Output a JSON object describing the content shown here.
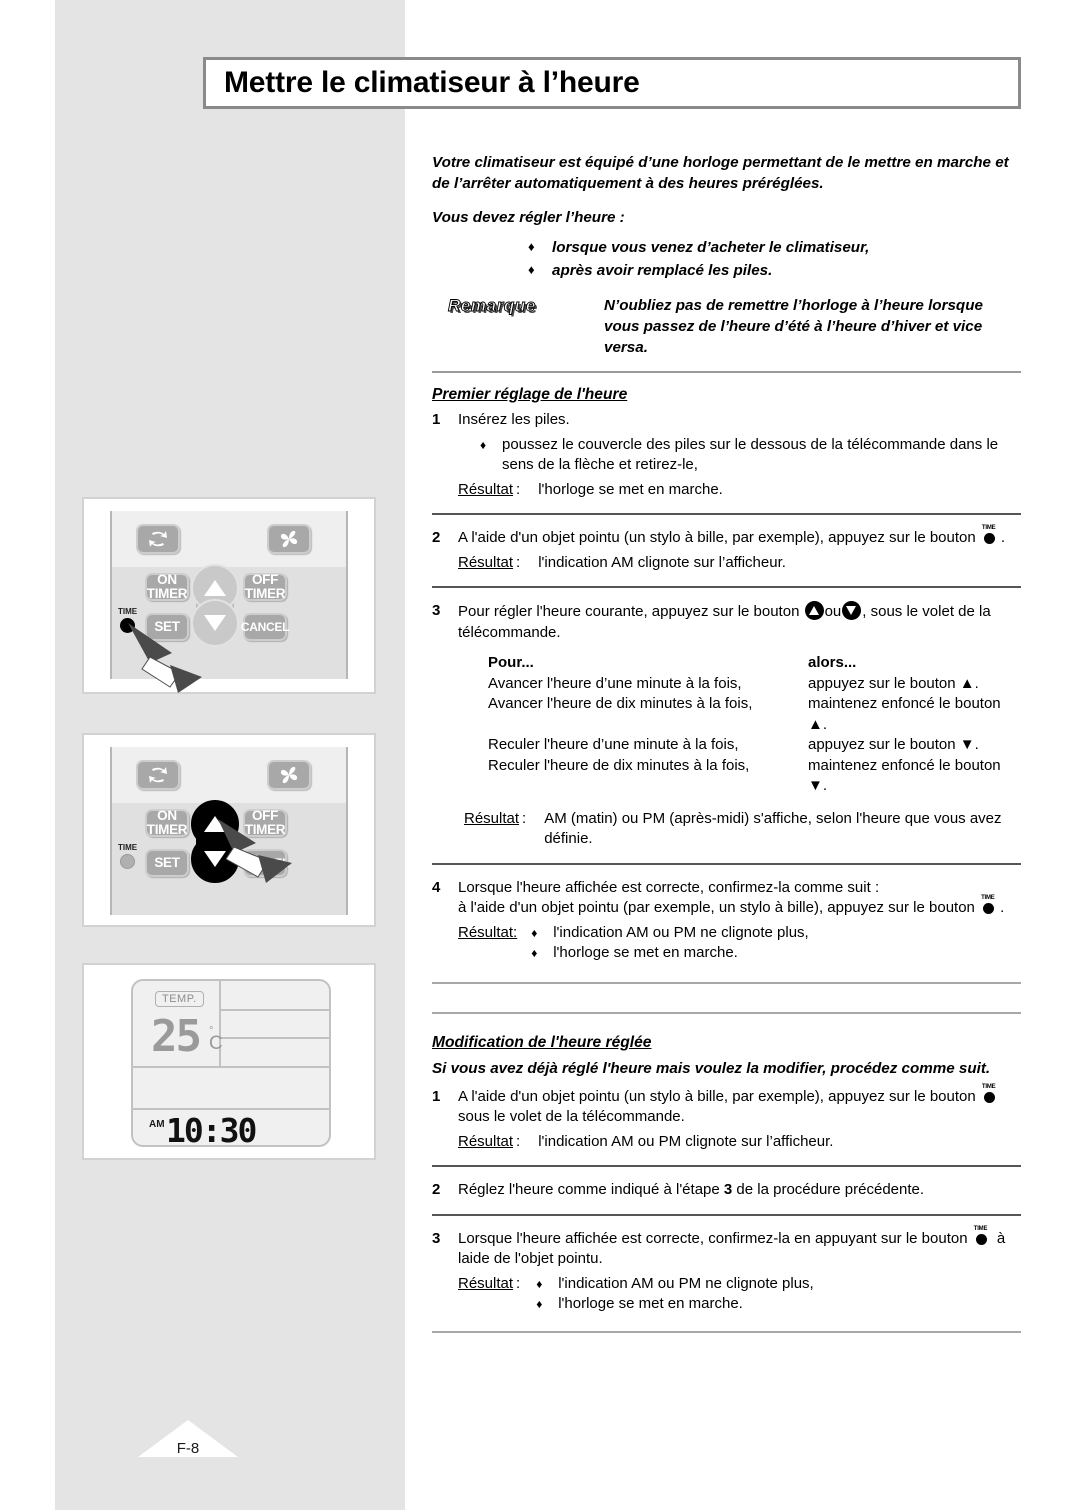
{
  "title": "Mettre le climatiseur à l’heure",
  "page_number": "F-8",
  "intro": {
    "para1": "Votre climatiseur est équipé d’une horloge permettant de le mettre en marche et de l’arrêter automatiquement à des heures préréglées.",
    "para2": "Vous devez régler l’heure :",
    "bullets": [
      "lorsque vous venez d’acheter le climatiseur,",
      "après avoir remplacé les piles."
    ],
    "remarque_label": "Remarque",
    "remarque_text": "N’oubliez pas de remettre l’horloge à l’heure lorsque vous passez de l’heure d’été à l’heure d’hiver et vice versa."
  },
  "section1": {
    "heading": "Premier réglage de l'heure",
    "step1": {
      "num": "1",
      "text": "Insérez les piles.",
      "bullet": "poussez le couvercle des piles sur le dessous de la télécommande dans le sens de la flèche et retirez-le,",
      "result_label": "Résultat",
      "result_colon": ":",
      "result_text": "l'horloge se met en marche."
    },
    "step2": {
      "num": "2",
      "text_before": "A l'aide d'un objet pointu (un stylo à bille, par exemple), appuyez sur le bouton",
      "text_after": ".",
      "result_label": "Résultat",
      "result_colon": ":",
      "result_text": "l'indication AM clignote sur l’afficheur."
    },
    "step3": {
      "num": "3",
      "text_before": "Pour régler l'heure courante, appuyez sur le bouton",
      "text_mid": "ou",
      "text_after": ", sous le volet de la télécommande.",
      "table": {
        "headers": [
          "Pour...",
          "alors..."
        ],
        "rows": [
          [
            "Avancer l'heure d’une minute à la fois,",
            "appuyez sur le bouton ▲."
          ],
          [
            "Avancer l'heure de dix minutes à la fois,",
            "maintenez enfoncé le bouton ▲."
          ],
          [
            "Reculer l'heure d’une minute à la fois,",
            "appuyez sur le bouton ▼."
          ],
          [
            "Reculer l'heure de dix minutes à la fois,",
            "maintenez enfoncé le bouton ▼."
          ]
        ]
      },
      "result_label": "Résultat",
      "result_colon": ":",
      "result_text": "AM (matin) ou PM (après-midi) s'affiche, selon l'heure que vous avez définie."
    },
    "step4": {
      "num": "4",
      "line1": "Lorsque l'heure affichée est correcte, confirmez-la comme suit :",
      "line2_before": "à l'aide d'un objet pointu (par exemple, un stylo à bille), appuyez sur le bouton",
      "line2_after": ".",
      "result_label": "Résultat:",
      "results": [
        "l'indication AM ou PM ne clignote plus,",
        "l'horloge se met en marche."
      ]
    }
  },
  "section2": {
    "heading": "Modification de l'heure réglée",
    "intro": "Si vous avez déjà réglé l'heure mais voulez la modifier, procédez comme suit.",
    "step1": {
      "num": "1",
      "text_before": "A l'aide d'un objet pointu (un stylo à bille, par exemple), appuyez sur le bouton",
      "text_after": "sous le volet de la télécommande.",
      "result_label": "Résultat",
      "result_colon": ":",
      "result_text": "l'indication AM ou PM clignote sur l’afficheur."
    },
    "step2": {
      "num": "2",
      "text_a": "Réglez l'heure comme indiqué à l'étape",
      "bold_ref": "3",
      "text_b": "de la procédure précédente."
    },
    "step3": {
      "num": "3",
      "text_before": "Lorsque l'heure affichée est correcte, confirmez-la en appuyant sur le bouton",
      "text_after": "à laide de l'objet pointu.",
      "result_label": "Résultat",
      "result_colon": ":",
      "results": [
        "l'indication AM ou PM ne clignote plus,",
        "l'horloge se met en marche."
      ]
    }
  },
  "illustrations": {
    "remote_buttons": {
      "swing": "swing-icon",
      "fan": "fan-icon",
      "on_timer_line1": "ON",
      "on_timer_line2": "TIMER",
      "off_timer_line1": "OFF",
      "off_timer_line2": "TIMER",
      "set": "SET",
      "cancel": "CANCEL",
      "time_label": "TIME"
    },
    "lcd": {
      "temp_badge": "TEMP.",
      "temperature": "25",
      "degree": "°",
      "unit": "C",
      "meridiem": "AM",
      "clock": "10:30"
    }
  }
}
